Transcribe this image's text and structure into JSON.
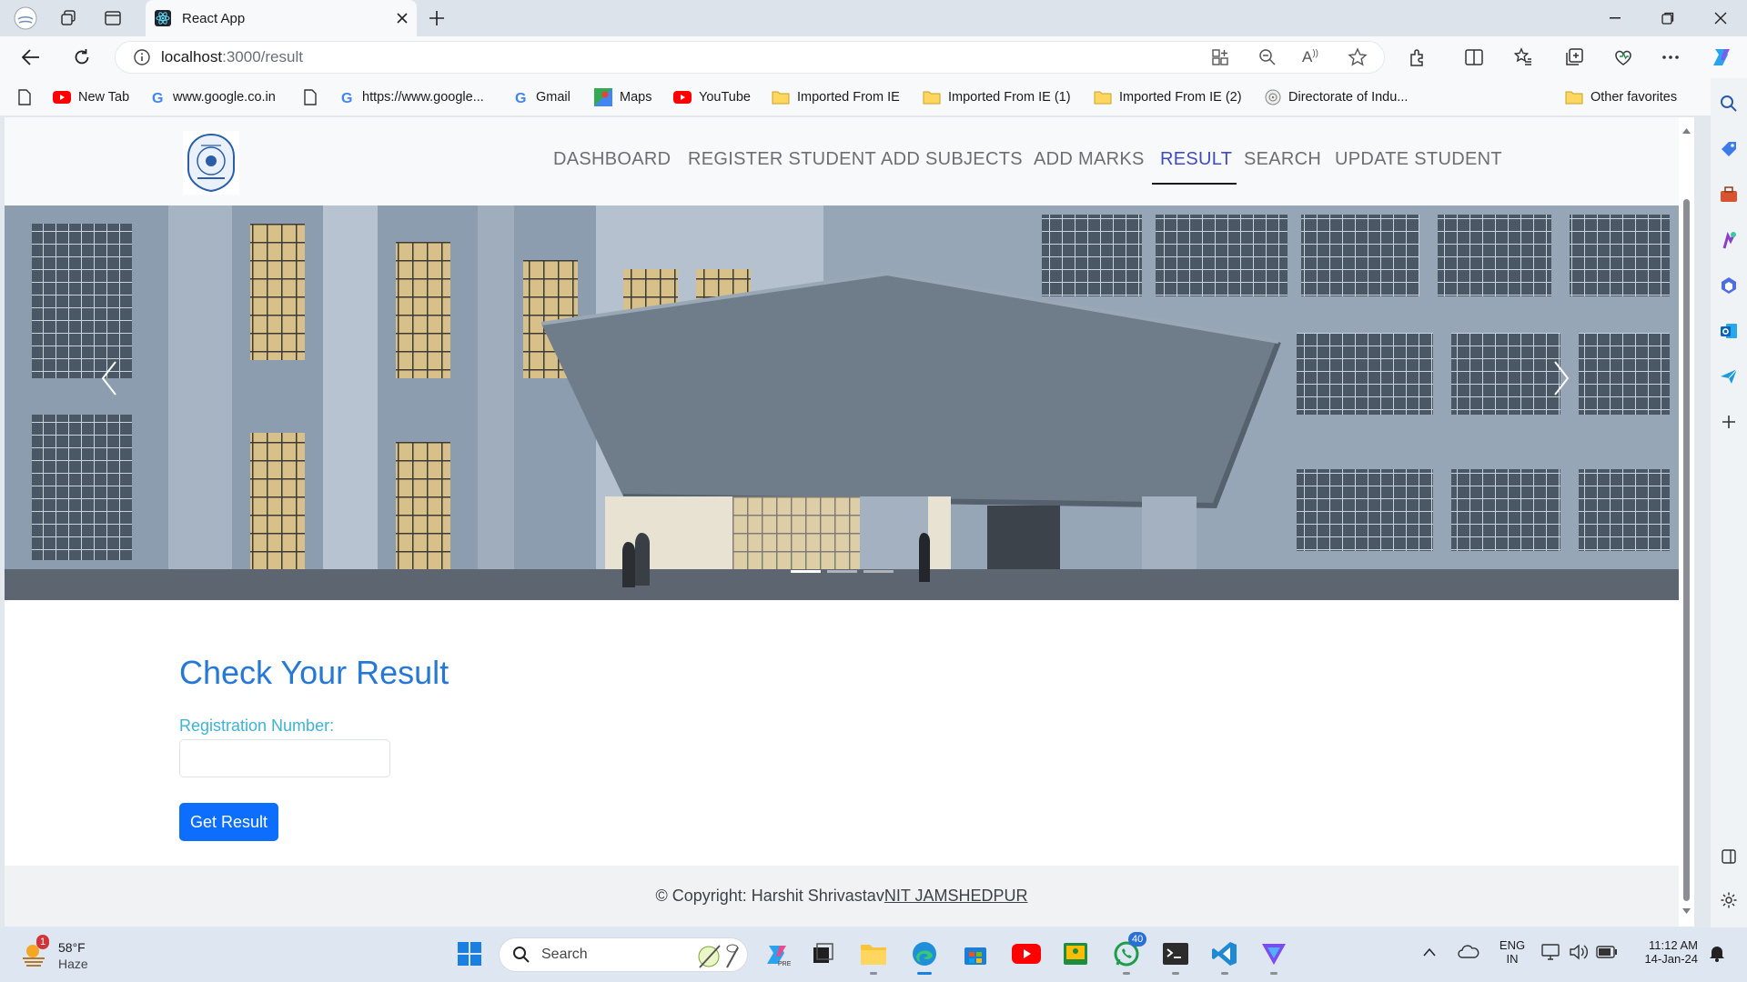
{
  "browser": {
    "tab_title": "React App",
    "url_host": "localhost",
    "url_path": ":3000/result",
    "favorites": [
      {
        "label": "New Tab",
        "icon": "youtube-icon"
      },
      {
        "label": "www.google.co.in",
        "icon": "google-icon"
      },
      {
        "label": "https://www.google...",
        "icon": "google-icon"
      },
      {
        "label": "Gmail",
        "icon": "google-icon"
      },
      {
        "label": "Maps",
        "icon": "maps-icon"
      },
      {
        "label": "YouTube",
        "icon": "youtube-icon"
      },
      {
        "label": "Imported From IE",
        "icon": "folder-icon"
      },
      {
        "label": "Imported From IE (1)",
        "icon": "folder-icon"
      },
      {
        "label": "Imported From IE (2)",
        "icon": "folder-icon"
      },
      {
        "label": "Directorate of Indu...",
        "icon": "emblem-icon"
      }
    ],
    "other_favorites": "Other favorites"
  },
  "app": {
    "nav": [
      {
        "label": "DASHBOARD",
        "active": false
      },
      {
        "label": "REGISTER STUDENT",
        "active": false
      },
      {
        "label": "ADD SUBJECTS",
        "active": false
      },
      {
        "label": "ADD MARKS",
        "active": false
      },
      {
        "label": "RESULT",
        "active": true
      },
      {
        "label": "SEARCH",
        "active": false
      },
      {
        "label": "UPDATE STUDENT",
        "active": false
      }
    ],
    "carousel": {
      "slide_count": 3,
      "active_slide": 1
    },
    "heading": "Check Your Result",
    "reg_label": "Registration Number:",
    "reg_value": "",
    "button": "Get Result",
    "footer_prefix": "© Copyright: Harshit Shrivastav",
    "footer_link": "NIT JAMSHEDPUR"
  },
  "taskbar": {
    "weather_temp": "58°F",
    "weather_desc": "Haze",
    "weather_badge": "1",
    "search_placeholder": "Search",
    "whatsapp_badge": "40",
    "lang_top": "ENG",
    "lang_bottom": "IN",
    "time": "11:12 AM",
    "date": "14-Jan-24"
  },
  "colors": {
    "accent": "#0d6efd",
    "heading": "#2678d6",
    "label": "#3cb4d6",
    "nav_active": "#3f48cc"
  }
}
